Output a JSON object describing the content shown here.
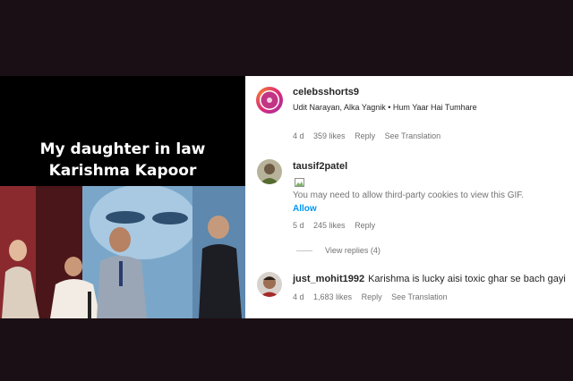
{
  "video": {
    "caption_line1": "My daughter in law",
    "caption_line2": "Karishma Kapoor"
  },
  "post": {
    "username": "celebsshorts9",
    "audio": "Udit Narayan, Alka Yagnik • Hum Yaar Hai Tumhare",
    "age": "4 d",
    "likes": "359 likes",
    "reply_label": "Reply",
    "translate_label": "See Translation"
  },
  "comments": [
    {
      "username": "tausif2patel",
      "notice": "You may need to allow third-party cookies to view this GIF.",
      "allow_label": "Allow",
      "age": "5 d",
      "likes": "245 likes",
      "reply_label": "Reply",
      "view_replies": "View replies (4)"
    },
    {
      "username": "just_mohit1992",
      "text": "Karishma is lucky aisi toxic ghar se bach gayi",
      "age": "4 d",
      "likes": "1,683 likes",
      "reply_label": "Reply",
      "translate_label": "See Translation"
    }
  ],
  "colors": {
    "background": "#1a0f14",
    "link_blue": "#0095f6",
    "muted_text": "#737373",
    "brand_gradient": "#c13584"
  }
}
